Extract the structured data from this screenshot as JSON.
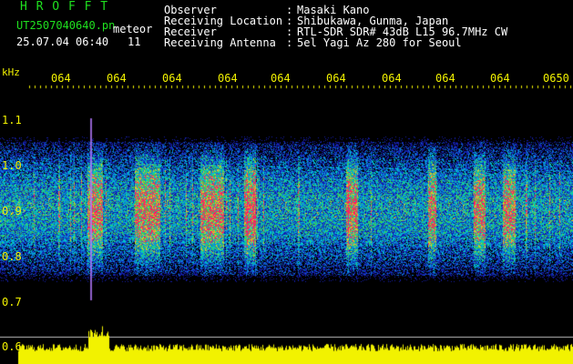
{
  "app": {
    "title": "H R O F F T",
    "file": "UT2507040640.pn",
    "mode": "meteor",
    "datetime": "25.07.04 06:40",
    "count": "11"
  },
  "info": {
    "rows": [
      {
        "label": "Observer",
        "sep": ":",
        "value": "Masaki Kano"
      },
      {
        "label": "Receiving Location",
        "sep": ":",
        "value": "Shibukawa, Gunma, Japan"
      },
      {
        "label": "Receiver",
        "sep": ":",
        "value": "RTL-SDR SDR# 43dB L15 96.7MHz CW"
      },
      {
        "label": "Receiving Antenna",
        "sep": ":",
        "value": "5el Yagi Az 280 for Seoul"
      }
    ]
  },
  "axes": {
    "y_unit": "kHz",
    "y_ticks": [
      "1.1",
      "1.0",
      "0.9",
      "0.8",
      "0.7",
      "0.6"
    ],
    "x_ticks": [
      "064",
      "064",
      "064",
      "064",
      "064",
      "064",
      "064",
      "064",
      "064",
      "0650"
    ]
  },
  "colors": {
    "background": "#000000",
    "header_title": "#1fe01f",
    "text": "#ffffff",
    "axis": "#f2f200",
    "signal_low": "#1010c0",
    "signal_mid": "#00d0d0",
    "signal_high": "#ff2060"
  }
}
